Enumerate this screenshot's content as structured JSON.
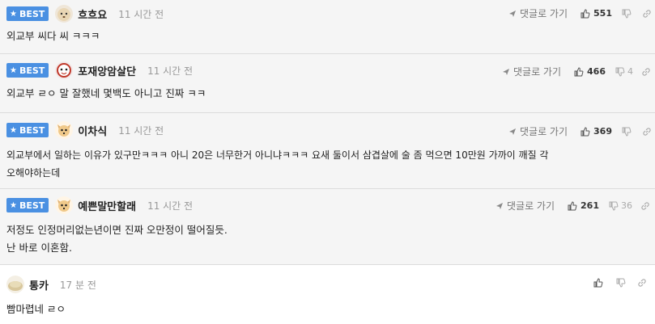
{
  "best_label": "BEST",
  "reply_label": "댓글로 가기",
  "comments": [
    {
      "nick": "흐흐요",
      "time": "11 시간 전",
      "likes": "551",
      "dislikes": "",
      "lines": [
        "외교부 씨다 씨 ㅋㅋㅋ"
      ]
    },
    {
      "nick": "포재앙암살단",
      "time": "11 시간 전",
      "likes": "466",
      "dislikes": "4",
      "lines": [
        "외교부 ㄹㅇ 말 잘했네 몇백도 아니고 진짜 ㅋㅋ"
      ]
    },
    {
      "nick": "이차식",
      "time": "11 시간 전",
      "likes": "369",
      "dislikes": "",
      "lines": [
        "외교부에서 일하는 이유가 있구만ㅋㅋㅋ 아니 20은 너무한거 아니냐ㅋㅋㅋ 요새 둘이서 삼겹살에 술 좀 먹으면 10만원 가까이 깨질 각",
        "오해야하는데"
      ]
    },
    {
      "nick": "예쁜말만할래",
      "time": "11 시간 전",
      "likes": "261",
      "dislikes": "36",
      "lines": [
        "저정도 인정머리없는년이면 진짜 오만정이 떨어질듯.",
        "난 바로 이혼함."
      ]
    },
    {
      "nick": "통카",
      "time": "17 분 전",
      "likes": "",
      "dislikes": "",
      "lines": [
        "빰마렵네 ㄹㅇ"
      ]
    }
  ]
}
